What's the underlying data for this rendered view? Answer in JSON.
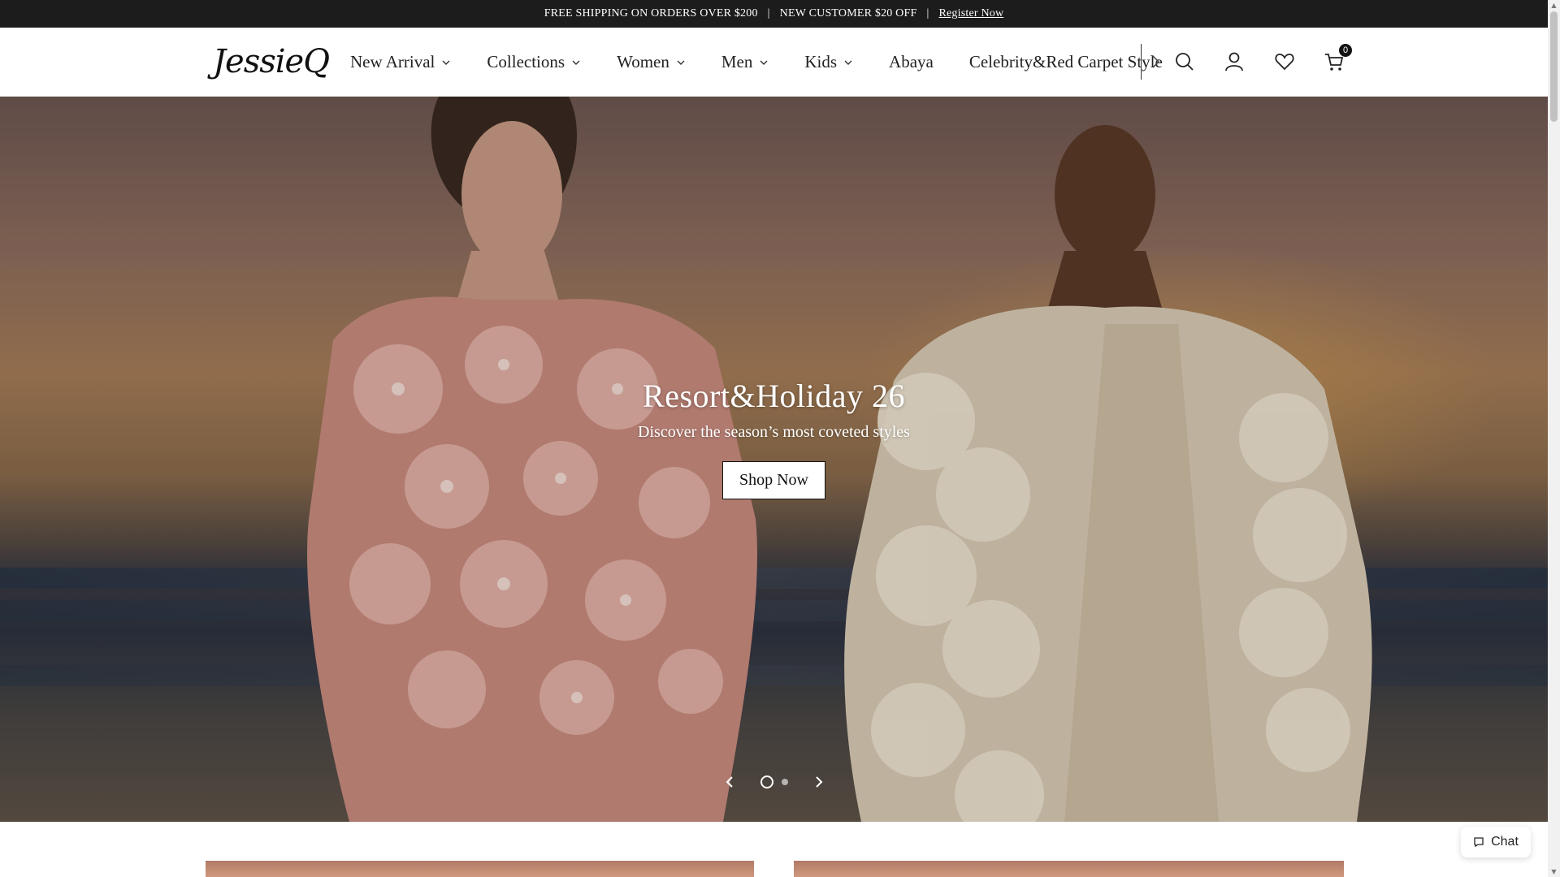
{
  "announcement": {
    "shipping": "FREE SHIPPING ON ORDERS OVER $200",
    "separator": "|",
    "new_customer": "NEW CUSTOMER $20 OFF",
    "register_link": "Register Now"
  },
  "header": {
    "logo_text": "JessieQ",
    "nav": [
      {
        "label": "New Arrival",
        "has_dropdown": true
      },
      {
        "label": "Collections",
        "has_dropdown": true
      },
      {
        "label": "Women",
        "has_dropdown": true
      },
      {
        "label": "Men",
        "has_dropdown": true
      },
      {
        "label": "Kids",
        "has_dropdown": true
      },
      {
        "label": "Abaya",
        "has_dropdown": false
      },
      {
        "label": "Celebrity&Red Carpet Style",
        "has_dropdown": false
      }
    ],
    "icons": [
      "chevron-right-icon",
      "search-icon",
      "account-icon",
      "heart-icon",
      "cart-icon"
    ],
    "cart_count": "0"
  },
  "hero": {
    "title": "Resort&Holiday 26",
    "subtitle": "Discover the season’s most coveted styles",
    "button_label": "Shop Now",
    "slide_count": 2,
    "active_slide": 1
  },
  "chat": {
    "label": "Chat"
  },
  "colors": {
    "announcement_bg": "#1c1c1c",
    "text": "#1a1a1a",
    "button_bg": "#ffffff"
  }
}
